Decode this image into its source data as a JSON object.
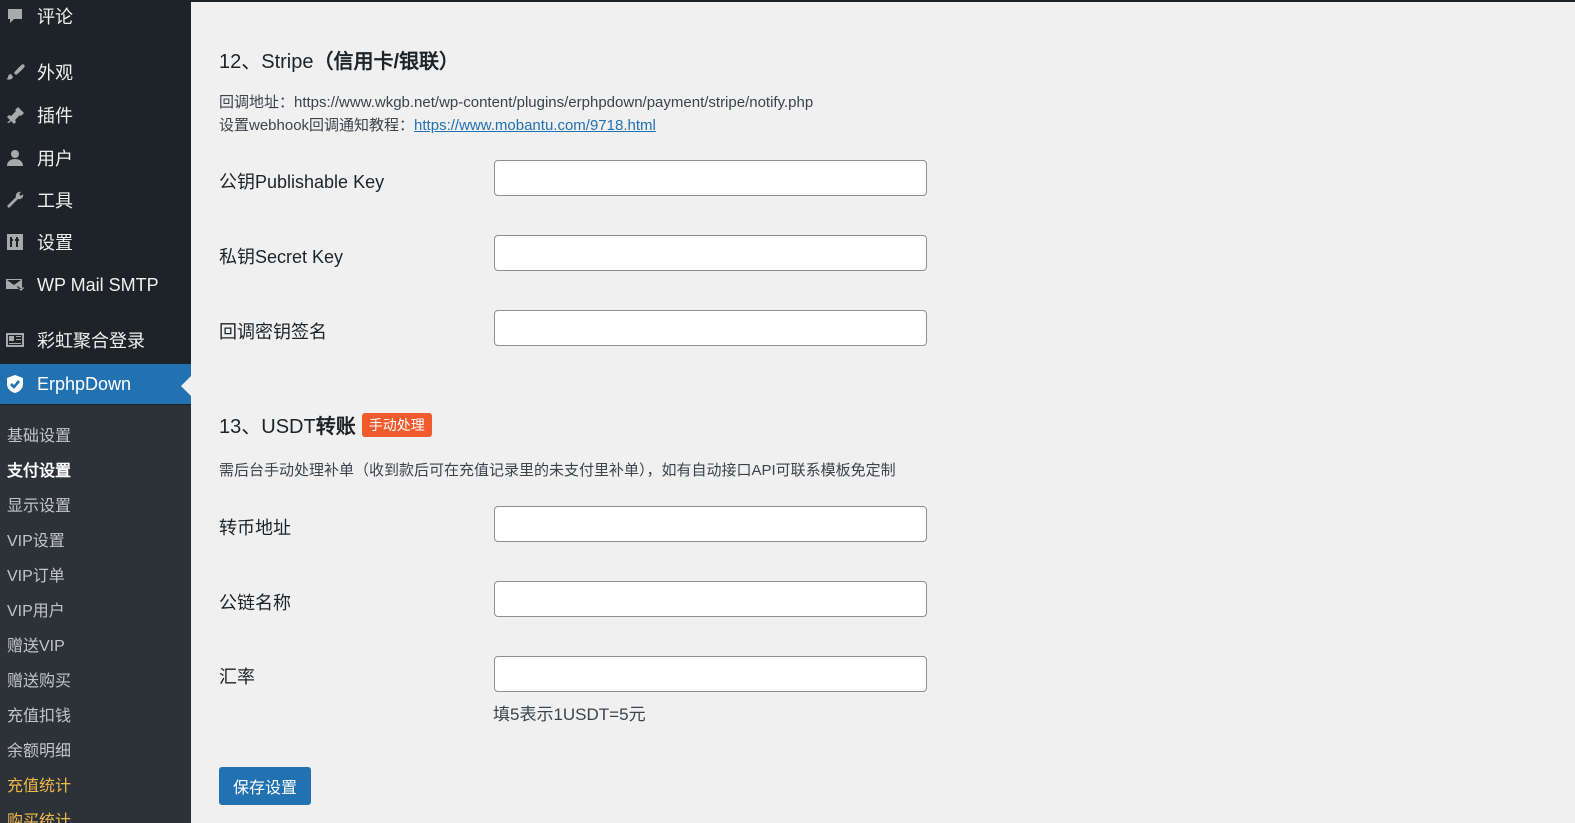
{
  "sidebar": {
    "menu": [
      {
        "label": "评论",
        "icon": "comment-icon"
      },
      {
        "label": "外观",
        "icon": "paintbrush-icon"
      },
      {
        "label": "插件",
        "icon": "plugin-icon"
      },
      {
        "label": "用户",
        "icon": "user-icon"
      },
      {
        "label": "工具",
        "icon": "wrench-icon"
      },
      {
        "label": "设置",
        "icon": "settings-icon"
      },
      {
        "label": "WP Mail SMTP",
        "icon": "mail-icon"
      },
      {
        "label": "彩虹聚合登录",
        "icon": "id-card-icon"
      },
      {
        "label": "ErphpDown",
        "icon": "shield-icon"
      }
    ],
    "submenu": [
      "基础设置",
      "支付设置",
      "显示设置",
      "VIP设置",
      "VIP订单",
      "VIP用户",
      "赠送VIP",
      "赠送购买",
      "充值扣钱",
      "余额明细",
      "充值统计",
      "购买统计"
    ]
  },
  "stripe": {
    "title_prefix": "12、Stripe",
    "title_suffix": "（信用卡/银联）",
    "callback_label": "回调地址：https://www.wkgb.net/wp-content/plugins/erphpdown/payment/stripe/notify.php",
    "webhook_label": "设置webhook回调通知教程：",
    "webhook_link": "https://www.mobantu.com/9718.html",
    "fields": [
      {
        "label": "公钥Publishable Key",
        "value": ""
      },
      {
        "label": "私钥Secret Key",
        "value": ""
      },
      {
        "label": "回调密钥签名",
        "value": ""
      }
    ]
  },
  "usdt": {
    "title_prefix": "13、USDT",
    "title_suffix": "转账",
    "badge": "手动处理",
    "description": "需后台手动处理补单（收到款后可在充值记录里的未支付里补单），如有自动接口API可联系模板免定制",
    "fields": [
      {
        "label": "转币地址",
        "value": ""
      },
      {
        "label": "公链名称",
        "value": ""
      },
      {
        "label": "汇率",
        "value": ""
      }
    ],
    "rate_hint": "填5表示1USDT=5元"
  },
  "save_button": "保存设置"
}
